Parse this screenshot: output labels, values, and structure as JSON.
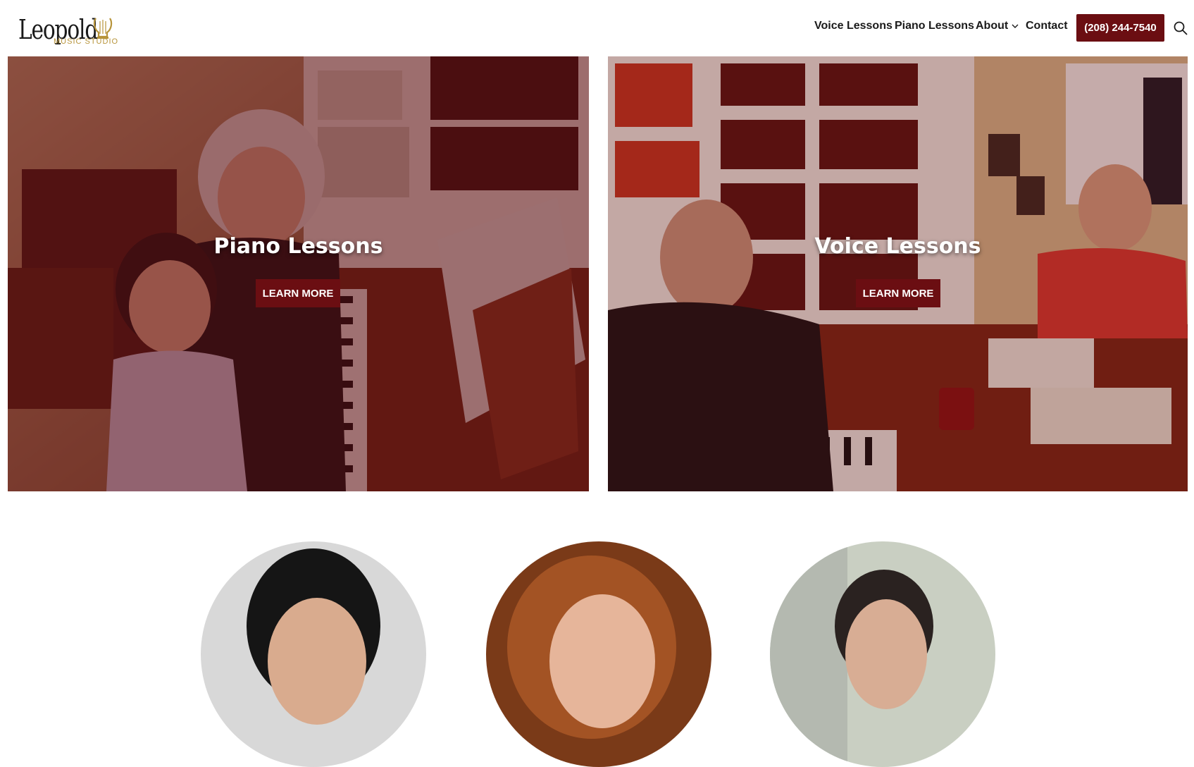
{
  "header": {
    "logo": {
      "wordmark": "Leopold",
      "subtitle": "MUSIC STUDIO"
    },
    "nav": {
      "voice": "Voice Lessons",
      "piano": "Piano Lessons",
      "about": "About",
      "contact": "Contact"
    },
    "phone": "(208) 244-7540"
  },
  "panels": [
    {
      "title": "Piano Lessons",
      "button": "LEARN MORE"
    },
    {
      "title": "Voice Lessons",
      "button": "LEARN MORE"
    }
  ],
  "colors": {
    "brand": "#6b0e12",
    "logo_gold": "#b7943a",
    "panel_tint": "#5a0a10"
  },
  "icons": [
    "lyre-icon",
    "chevron-down-icon",
    "search-icon"
  ]
}
